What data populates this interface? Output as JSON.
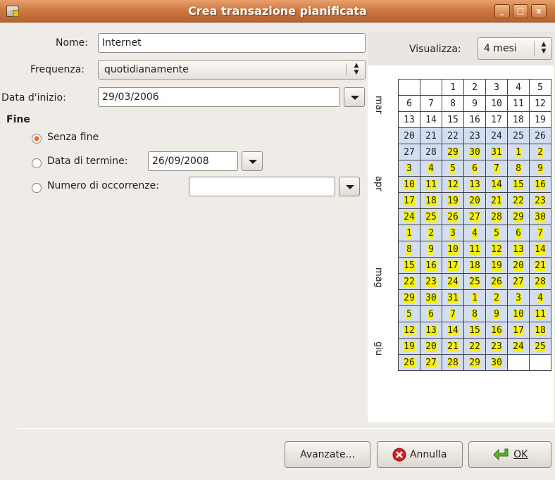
{
  "window": {
    "title": "Crea transazione pianificata",
    "buttons": [
      "_",
      "□",
      "x"
    ]
  },
  "form": {
    "name_label": "Nome:",
    "name_value": "Internet",
    "frequency_label": "Frequenza:",
    "frequency_value": "quotidianamente",
    "start_label": "Data d'inizio:",
    "start_value": "29/03/2006",
    "end_section": "Fine",
    "opt_no_end": "Senza fine",
    "opt_end_date": "Data di termine:",
    "end_date_value": "26/09/2008",
    "opt_occurrences": "Numero di occorrenze:",
    "occurrences_value": "",
    "selected_option": "no_end"
  },
  "calendar": {
    "view_label": "Visualizza:",
    "view_value": "4 mesi",
    "months": [
      "mar",
      "apr",
      "mag",
      "giu"
    ],
    "highlight_color": "#f6f20f",
    "weeks": [
      [
        "",
        "",
        "1",
        "2",
        "3",
        "4",
        "5"
      ],
      [
        "6",
        "7",
        "8",
        "9",
        "10",
        "11",
        "12"
      ],
      [
        "13",
        "14",
        "15",
        "16",
        "17",
        "18",
        "19"
      ],
      [
        "20",
        "21",
        "22",
        "23",
        "24",
        "25",
        "26"
      ],
      [
        "27",
        "28",
        "29",
        "30",
        "31",
        "1",
        "2"
      ],
      [
        "3",
        "4",
        "5",
        "6",
        "7",
        "8",
        "9"
      ],
      [
        "10",
        "11",
        "12",
        "13",
        "14",
        "15",
        "16"
      ],
      [
        "17",
        "18",
        "19",
        "20",
        "21",
        "22",
        "23"
      ],
      [
        "24",
        "25",
        "26",
        "27",
        "28",
        "29",
        "30"
      ],
      [
        "1",
        "2",
        "3",
        "4",
        "5",
        "6",
        "7"
      ],
      [
        "8",
        "9",
        "10",
        "11",
        "12",
        "13",
        "14"
      ],
      [
        "15",
        "16",
        "17",
        "18",
        "19",
        "20",
        "21"
      ],
      [
        "22",
        "23",
        "24",
        "25",
        "26",
        "27",
        "28"
      ],
      [
        "29",
        "30",
        "31",
        "1",
        "2",
        "3",
        "4"
      ],
      [
        "5",
        "6",
        "7",
        "8",
        "9",
        "10",
        "11"
      ],
      [
        "12",
        "13",
        "14",
        "15",
        "16",
        "17",
        "18"
      ],
      [
        "19",
        "20",
        "21",
        "22",
        "23",
        "24",
        "25"
      ],
      [
        "26",
        "27",
        "28",
        "29",
        "30",
        "",
        ""
      ]
    ]
  },
  "buttons": {
    "advanced": "Avanzate...",
    "cancel": "Annulla",
    "ok": "OK"
  }
}
